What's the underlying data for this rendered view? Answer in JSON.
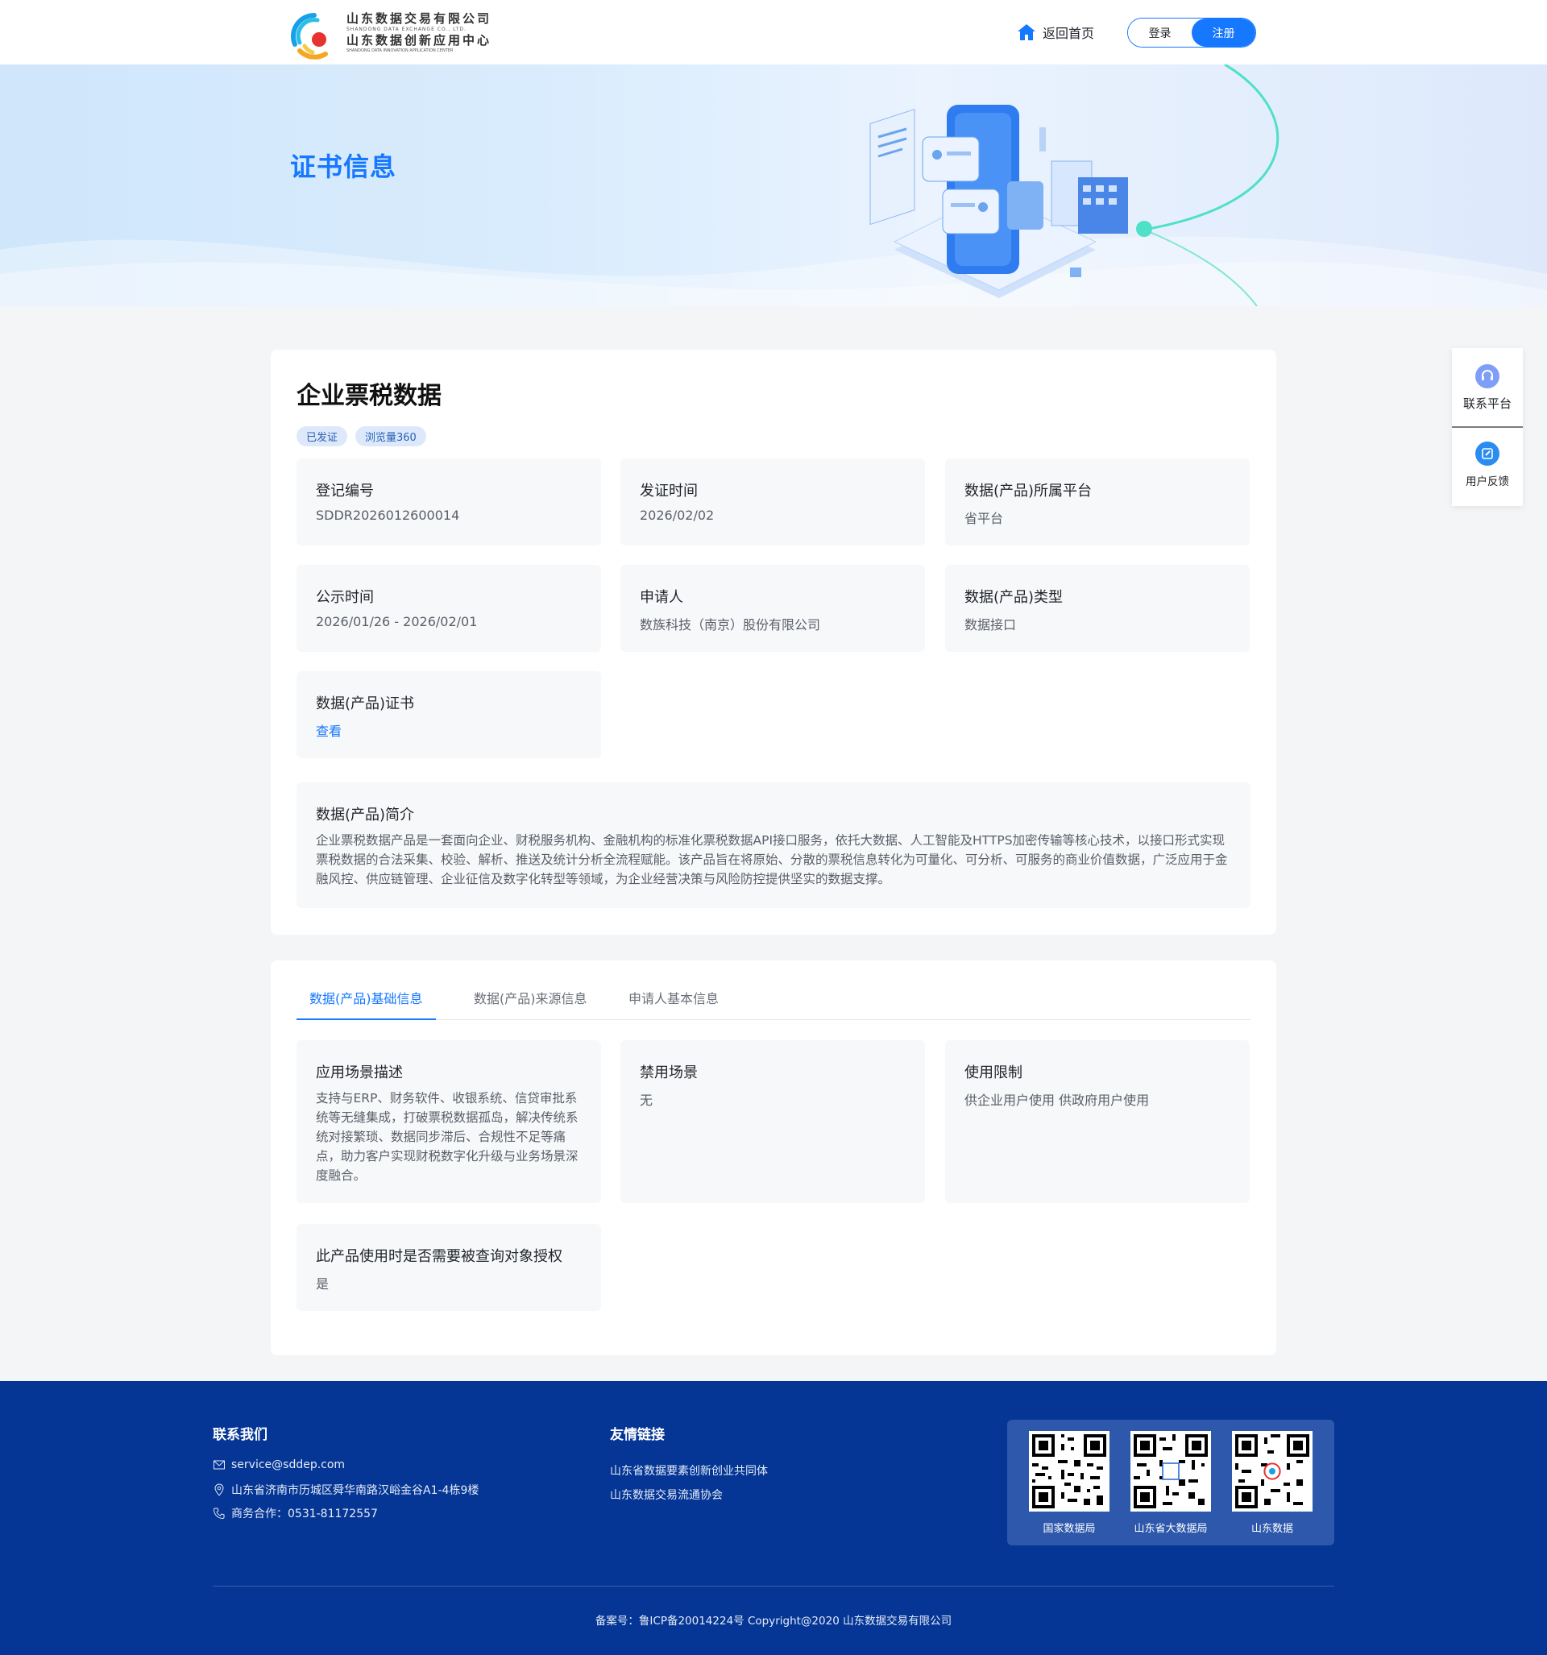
{
  "header": {
    "logo_cn_1": "山东数据交易有限公司",
    "logo_en_1": "SHANDONG DATA EXCHANGE CO., LTD.",
    "logo_cn_2": "山东数据创新应用中心",
    "logo_en_2": "SHANDONG DATA INNOVATION APPLICATION CENTER",
    "home_label": "返回首页",
    "login_label": "登录",
    "register_label": "注册"
  },
  "banner": {
    "title": "证书信息"
  },
  "product": {
    "name": "企业票税数据",
    "tags": [
      "已发证",
      "浏览量360"
    ],
    "fields": [
      {
        "label": "登记编号",
        "value": "SDDR2026012600014"
      },
      {
        "label": "发证时间",
        "value": "2026/02/02"
      },
      {
        "label": "数据(产品)所属平台",
        "value": "省平台"
      },
      {
        "label": "公示时间",
        "value": "2026/01/26 - 2026/02/01"
      },
      {
        "label": "申请人",
        "value": "数族科技（南京）股份有限公司"
      },
      {
        "label": "数据(产品)类型",
        "value": "数据接口"
      },
      {
        "label": "数据(产品)证书",
        "value": "查看"
      }
    ],
    "intro_label": "数据(产品)简介",
    "intro_text": "企业票税数据产品是一套面向企业、财税服务机构、金融机构的标准化票税数据API接口服务，依托大数据、人工智能及HTTPS加密传输等核心技术，以接口形式实现票税数据的合法采集、校验、解析、推送及统计分析全流程赋能。该产品旨在将原始、分散的票税信息转化为可量化、可分析、可服务的商业价值数据，广泛应用于金融风控、供应链管理、企业征信及数字化转型等领域，为企业经营决策与风险防控提供坚实的数据支撑。"
  },
  "tabs": {
    "items": [
      "数据(产品)基础信息",
      "数据(产品)来源信息",
      "申请人基本信息"
    ],
    "active": 0,
    "fields": [
      {
        "label": "应用场景描述",
        "value": "支持与ERP、财务软件、收银系统、信贷审批系统等无缝集成，打破票税数据孤岛，解决传统系统对接繁琐、数据同步滞后、合规性不足等痛点，助力客户实现财税数字化升级与业务场景深度融合。"
      },
      {
        "label": "禁用场景",
        "value": "无"
      },
      {
        "label": "使用限制",
        "value": "供企业用户使用 供政府用户使用"
      },
      {
        "label": "此产品使用时是否需要被查询对象授权",
        "value": "是"
      }
    ]
  },
  "side_panel": {
    "contact_label": "联系平台",
    "feedback_label": "用户反馈"
  },
  "footer": {
    "contact_title": "联系我们",
    "email": "service@sddep.com",
    "address": "山东省济南市历城区舜华南路汉峪金谷A1-4栋9楼",
    "phone": "商务合作：0531-81172557",
    "links_title": "友情链接",
    "links": [
      "山东省数据要素创新创业共同体",
      "山东数据交易流通协会"
    ],
    "qr_codes": [
      "国家数据局",
      "山东省大数据局",
      "山东数据"
    ],
    "copyright": "备案号：鲁ICP备20014224号 Copyright@2020 山东数据交易有限公司"
  },
  "colors": {
    "accent": "#1677ff",
    "footer_bg": "#053695",
    "tag_bg": "#dde9fb",
    "box_bg": "#f7f8fa"
  }
}
